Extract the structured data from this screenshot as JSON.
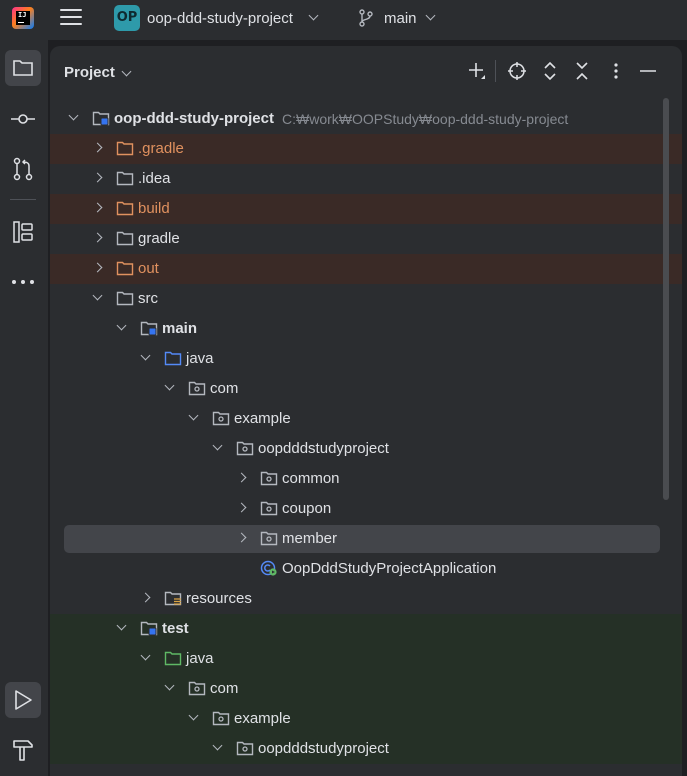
{
  "titlebar": {
    "project_badge": "OP",
    "project_name": "oop-ddd-study-project",
    "branch": "main"
  },
  "panel": {
    "title": "Project"
  },
  "colors": {
    "excluded_folder_text": "#e0915f",
    "source_folder": "#548af7",
    "test_folder": "#5fb865"
  },
  "tree": [
    {
      "label": "oop-ddd-study-project",
      "path": "C:₩work₩OOPStudy₩oop-ddd-study-project",
      "icon": "module-folder-icon",
      "expanded": true
    },
    {
      "label": ".gradle",
      "icon": "excluded-folder-icon",
      "expanded": false
    },
    {
      "label": ".idea",
      "icon": "folder-icon",
      "expanded": false
    },
    {
      "label": "build",
      "icon": "excluded-folder-icon",
      "expanded": false
    },
    {
      "label": "gradle",
      "icon": "folder-icon",
      "expanded": false
    },
    {
      "label": "out",
      "icon": "excluded-folder-icon",
      "expanded": false
    },
    {
      "label": "src",
      "icon": "folder-icon",
      "expanded": true
    },
    {
      "label": "main",
      "icon": "module-folder-icon",
      "expanded": true
    },
    {
      "label": "java",
      "icon": "source-folder-icon",
      "expanded": true
    },
    {
      "label": "com",
      "icon": "package-icon",
      "expanded": true
    },
    {
      "label": "example",
      "icon": "package-icon",
      "expanded": true
    },
    {
      "label": "oopdddstudyproject",
      "icon": "package-icon",
      "expanded": true
    },
    {
      "label": "common",
      "icon": "package-icon",
      "expanded": false
    },
    {
      "label": "coupon",
      "icon": "package-icon",
      "expanded": false
    },
    {
      "label": "member",
      "icon": "package-icon",
      "expanded": false
    },
    {
      "label": "OopDddStudyProjectApplication",
      "icon": "spring-boot-class-icon"
    },
    {
      "label": "resources",
      "icon": "resources-folder-icon",
      "expanded": false
    },
    {
      "label": "test",
      "icon": "module-folder-icon",
      "expanded": true
    },
    {
      "label": "java",
      "icon": "test-folder-icon",
      "expanded": true
    },
    {
      "label": "com",
      "icon": "package-icon",
      "expanded": true
    },
    {
      "label": "example",
      "icon": "package-icon",
      "expanded": true
    },
    {
      "label": "oopdddstudyproject",
      "icon": "package-icon",
      "expanded": true
    }
  ]
}
